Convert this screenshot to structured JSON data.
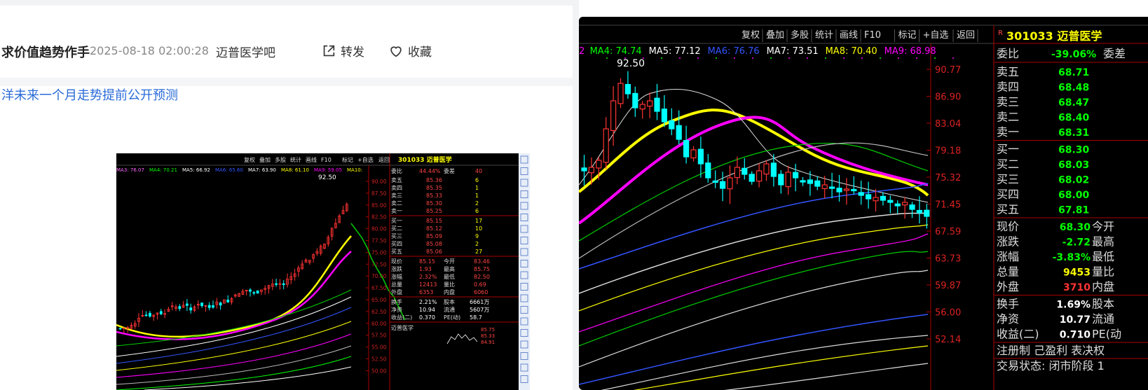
{
  "post": {
    "author": "求价值趋势作手",
    "date": "2025-08-18 02:00:28",
    "bar": "迈普医学吧",
    "forward_label": "转发",
    "favorite_label": "收藏",
    "title": "洋未来一个月走势提前公开预测"
  },
  "small_chart": {
    "menu": [
      "复权",
      "叠加",
      "多股",
      "统计",
      "画线",
      "F10",
      "标记",
      "+自选",
      "返回"
    ],
    "ma_line": [
      {
        "text": "MA3: 76.07",
        "color": "#ff66ff"
      },
      {
        "text": "MA4: 70.21",
        "color": "#00ff00"
      },
      {
        "text": "MA5: 66.92",
        "color": "#ffffff"
      },
      {
        "text": "MA6: 65.60",
        "color": "#3355ff"
      },
      {
        "text": "MA7: 63.90",
        "color": "#ffffff"
      },
      {
        "text": "MA8: 61.10",
        "color": "#ffff00"
      },
      {
        "text": "MA9: 59.05",
        "color": "#ff00ff"
      },
      {
        "text": "MA10:",
        "color": "#ffff00"
      }
    ],
    "high_marker": "92.50",
    "price_axis": [
      "90.00",
      "87.50",
      "85.00",
      "82.50",
      "80.00",
      "77.50",
      "75.00",
      "72.50",
      "70.00",
      "67.50",
      "65.00",
      "62.50",
      "60.00",
      "57.50",
      "55.00",
      "52.50",
      "50.00"
    ],
    "stock": {
      "code": "301033",
      "name": "迈普医学"
    },
    "weibi": {
      "label": "委比",
      "value": "44.44%",
      "label2": "委差",
      "value2": "40"
    },
    "sell": [
      {
        "label": "卖五",
        "price": "85.36",
        "vol": "6"
      },
      {
        "label": "卖四",
        "price": "85.35",
        "vol": "1"
      },
      {
        "label": "卖三",
        "price": "85.33",
        "vol": "1"
      },
      {
        "label": "卖二",
        "price": "85.30",
        "vol": "2"
      },
      {
        "label": "卖一",
        "price": "85.25",
        "vol": "6"
      }
    ],
    "buy": [
      {
        "label": "买一",
        "price": "85.15",
        "vol": "17"
      },
      {
        "label": "买二",
        "price": "85.12",
        "vol": "10"
      },
      {
        "label": "买三",
        "price": "85.09",
        "vol": "9"
      },
      {
        "label": "买四",
        "price": "85.08",
        "vol": "2"
      },
      {
        "label": "买五",
        "price": "85.06",
        "vol": "27"
      }
    ],
    "stats": [
      {
        "l": "现价",
        "v": "85.15",
        "l2": "今开",
        "v2": "83.46"
      },
      {
        "l": "涨跌",
        "v": "1.93",
        "l2": "最高",
        "v2": "85.75"
      },
      {
        "l": "涨幅",
        "v": "2.32%",
        "l2": "最低",
        "v2": "82.50"
      },
      {
        "l": "总量",
        "v": "12413",
        "l2": "量比",
        "v2": "0.69"
      },
      {
        "l": "外盘",
        "v": "6353",
        "l2": "内盘",
        "v2": "6060"
      }
    ],
    "stats2": [
      {
        "l": "换手",
        "v": "2.21%",
        "l2": "股本",
        "v2": "6661万"
      },
      {
        "l": "净资",
        "v": "10.94",
        "l2": "流通",
        "v2": "5607万"
      },
      {
        "l": "收益(二)",
        "v": "0.370",
        "l2": "PE(动)",
        "v2": "58.7"
      }
    ],
    "mini_name": "迈普医学",
    "mini_prices": [
      "85.75",
      "85.33",
      "84.91"
    ]
  },
  "big_chart": {
    "menu": [
      "复权",
      "叠加",
      "多股",
      "统计",
      "画线",
      "F10",
      "标记",
      "+自选",
      "返回"
    ],
    "ma_line": [
      {
        "text": "2",
        "color": "#ff00ff"
      },
      {
        "text": "MA4: 74.74",
        "color": "#00ff00"
      },
      {
        "text": "MA5: 77.12",
        "color": "#ffffff"
      },
      {
        "text": "MA6: 76.76",
        "color": "#3355ff"
      },
      {
        "text": "MA7: 73.51",
        "color": "#ffffff"
      },
      {
        "text": "MA8: 70.40",
        "color": "#ffff00"
      },
      {
        "text": "MA9: 68.98",
        "color": "#ff00ff"
      }
    ],
    "high_marker": "92.50",
    "price_axis": [
      "90.77",
      "86.90",
      "83.04",
      "79.18",
      "75.32",
      "71.45",
      "67.59",
      "63.73",
      "59.87",
      "56.00",
      "52.14"
    ],
    "stock": {
      "code": "301033",
      "name": "迈普医学"
    },
    "weibi": {
      "label": "委比",
      "value": "-39.06%",
      "label2": "委差"
    },
    "sell": [
      {
        "label": "卖五",
        "price": "68.71"
      },
      {
        "label": "卖四",
        "price": "68.48"
      },
      {
        "label": "卖三",
        "price": "68.47"
      },
      {
        "label": "卖二",
        "price": "68.40"
      },
      {
        "label": "卖一",
        "price": "68.31"
      }
    ],
    "buy": [
      {
        "label": "买一",
        "price": "68.30"
      },
      {
        "label": "买二",
        "price": "68.03"
      },
      {
        "label": "买三",
        "price": "68.02"
      },
      {
        "label": "买四",
        "price": "68.00"
      },
      {
        "label": "买五",
        "price": "67.81"
      }
    ],
    "stats": [
      {
        "l": "现价",
        "v": "68.30",
        "l2": "今开"
      },
      {
        "l": "涨跌",
        "v": "-2.72",
        "l2": "最高"
      },
      {
        "l": "涨幅",
        "v": "-3.83%",
        "l2": "最低"
      },
      {
        "l": "总量",
        "v": "9453",
        "l2": "量比"
      },
      {
        "l": "外盘",
        "v": "3710",
        "l2": "内盘"
      }
    ],
    "stats2": [
      {
        "l": "换手",
        "v": "1.69%",
        "l2": "股本"
      },
      {
        "l": "净资",
        "v": "10.77",
        "l2": "流通"
      },
      {
        "l": "收益(二)",
        "v": "0.710",
        "l2": "PE(动"
      }
    ],
    "footer1": "注册制 己盈利 表决权",
    "footer2": "交易状态: 闭市阶段 1"
  },
  "colors": {
    "link": "#2a6bd8",
    "up": "#ff3333",
    "down": "#00ffff",
    "axis": "#cc0000",
    "yellow": "#ffff00",
    "magenta": "#ff00ff"
  }
}
